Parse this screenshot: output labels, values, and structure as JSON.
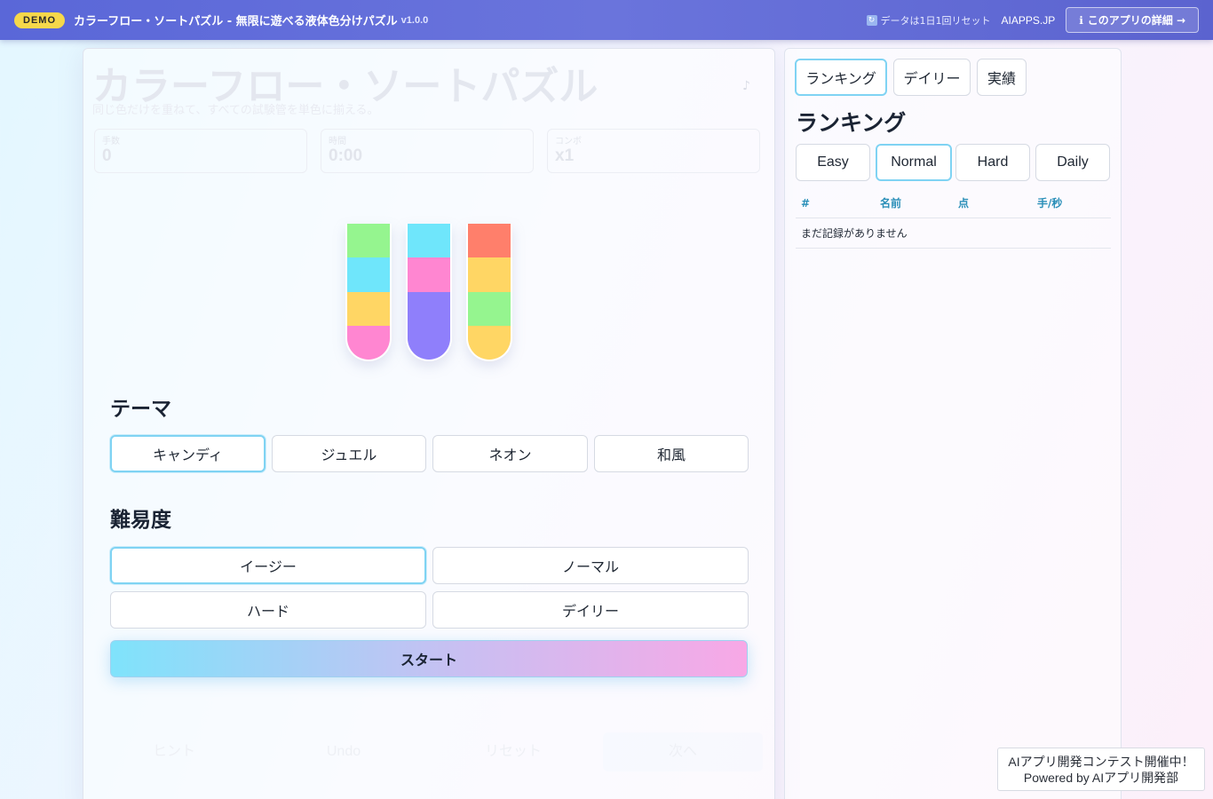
{
  "topbar": {
    "badge": "DEMO",
    "title": "カラーフロー・ソートパズル - 無限に遊べる液体色分けパズル",
    "version": "v1.0.0",
    "reset_note": "データは1日1回リセット",
    "site": "AIAPPS.JP",
    "detail_button": "このアプリの詳細 →"
  },
  "game": {
    "title": "カラーフロー・ソートパズル",
    "subtitle": "同じ色だけを重ねて、すべての試験管を単色に揃える。",
    "music_icon": "♪",
    "stats": [
      {
        "label": "手数",
        "value": "0"
      },
      {
        "label": "時間",
        "value": "0:00"
      },
      {
        "label": "コンボ",
        "value": "x1"
      }
    ],
    "tubes": [
      [
        "#95f58f",
        "#6fe6fb",
        "#ffd664",
        "#ff86d1"
      ],
      [
        "#6fe6fb",
        "#ff86d1",
        "#8f7ffb",
        "#8f7ffb"
      ],
      [
        "#ff7f6b",
        "#ffd664",
        "#95f58f",
        "#ffd664"
      ]
    ],
    "bottom_buttons": {
      "hint": "ヒント",
      "undo": "Undo",
      "reset": "リセット",
      "next": "次へ"
    }
  },
  "theme": {
    "title": "テーマ",
    "options": [
      "キャンディ",
      "ジュエル",
      "ネオン",
      "和風"
    ],
    "selected": "キャンディ"
  },
  "difficulty": {
    "title": "難易度",
    "options": [
      "イージー",
      "ノーマル",
      "ハード",
      "デイリー"
    ],
    "selected": "イージー"
  },
  "start_button": "スタート",
  "side": {
    "tabs": [
      "ランキング",
      "デイリー",
      "実績"
    ],
    "selected_tab": "ランキング",
    "title": "ランキング",
    "difficulty_tabs": [
      "Easy",
      "Normal",
      "Hard",
      "Daily"
    ],
    "selected_difficulty": "Normal",
    "table_headers": [
      "#",
      "名前",
      "点",
      "手/秒"
    ],
    "empty_message": "まだ記録がありません"
  },
  "contest": {
    "line1": "AIアプリ開発コンテスト開催中！",
    "line2": "Powered by AIアプリ開発部"
  }
}
